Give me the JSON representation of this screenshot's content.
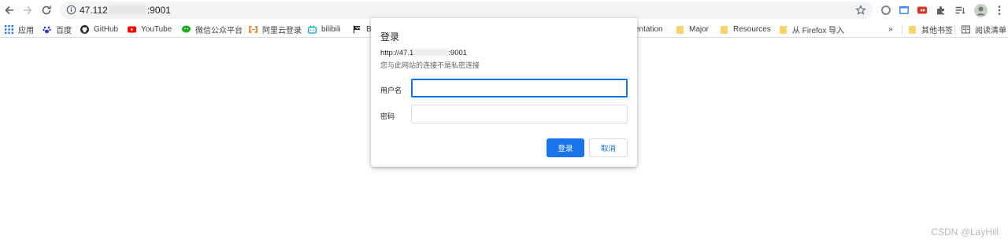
{
  "browser": {
    "address": {
      "url_prefix": "47.112",
      "url_suffix": ":9001"
    },
    "icons": [
      "back-arrow-icon",
      "forward-arrow-icon",
      "reload-icon",
      "site-info-icon",
      "bookmark-star-icon",
      "extension-icon",
      "extensions-puzzle-icon",
      "reading-list-icon",
      "profile-avatar",
      "kebab-menu-icon"
    ]
  },
  "bookmarks": {
    "items": [
      {
        "label": "应用",
        "icon": "apps-grid-icon"
      },
      {
        "label": "百度",
        "icon": "baidu-paw-icon"
      },
      {
        "label": "GitHub",
        "icon": "github-icon"
      },
      {
        "label": "YouTube",
        "icon": "youtube-icon"
      },
      {
        "label": "微信公众平台",
        "icon": "wechat-icon"
      },
      {
        "label": "阿里云登录",
        "icon": "aliyun-icon"
      },
      {
        "label": "bilibili",
        "icon": "bilibili-icon"
      },
      {
        "label": "B",
        "icon": "flag-icon"
      },
      {
        "label": "entation",
        "icon": ""
      },
      {
        "label": "Major",
        "icon": "folder-icon"
      },
      {
        "label": "Resources",
        "icon": "folder-icon"
      },
      {
        "label": "从 Firefox 导入",
        "icon": "folder-icon"
      }
    ],
    "overflow": "»",
    "other_bookmarks": "其他书签",
    "reading_list": "阅读清单"
  },
  "dialog": {
    "title": "登录",
    "origin_prefix": "http://47.1",
    "origin_suffix": ":9001",
    "warning": "您与此网站的连接不是私密连接",
    "username_label": "用户名",
    "username_value": "",
    "password_label": "密码",
    "password_value": "",
    "submit_label": "登录",
    "cancel_label": "取消"
  },
  "watermark": "CSDN @LayHill",
  "colors": {
    "accent": "#1a73e8",
    "omnibox": "#f1f3f4",
    "folder": "#fbd36b"
  }
}
